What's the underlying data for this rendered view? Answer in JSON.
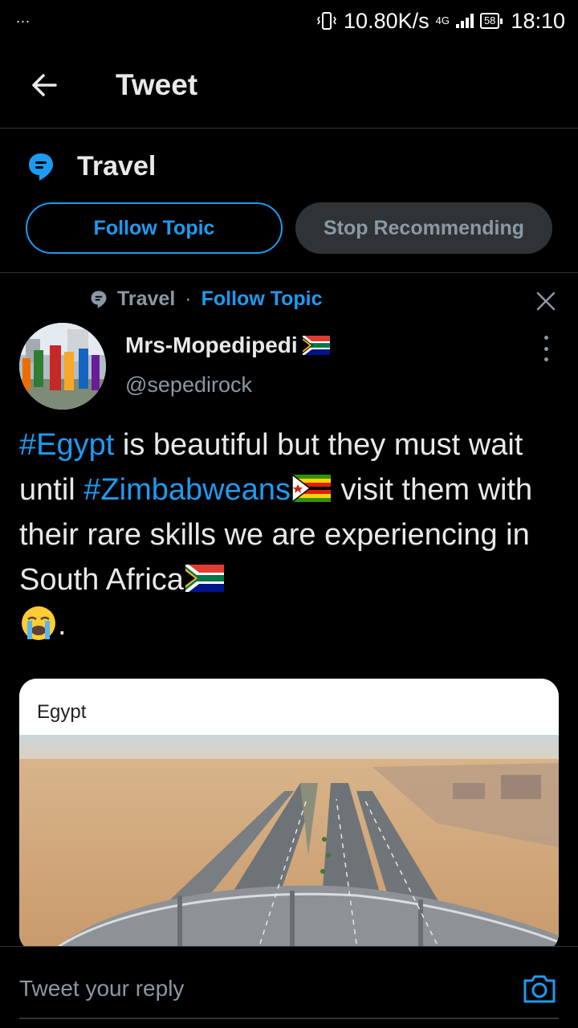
{
  "status_bar": {
    "dots": "...",
    "speed": "10.80K/s",
    "network": "4G",
    "battery": "58",
    "time": "18:10"
  },
  "header": {
    "back_icon": "arrow-left-icon",
    "title": "Tweet"
  },
  "topic_banner": {
    "icon": "topic-bubble-icon",
    "topic": "Travel",
    "follow_label": "Follow Topic",
    "stop_label": "Stop Recommending"
  },
  "tweet": {
    "context_topic": "Travel",
    "context_sep": "·",
    "context_follow": "Follow Topic",
    "author_name": "Mrs-Mopedipedi",
    "handle": "@sepedirock",
    "text": {
      "tag1": "#Egypt",
      "part1": " is beautiful but they must wait until ",
      "tag2": "#Zimbabweans",
      "part2": " visit them with their rare skills we are experiencing in South Africa",
      "part3": "."
    },
    "media": {
      "caption": "Egypt"
    }
  },
  "reply": {
    "placeholder": "Tweet your reply"
  },
  "colors": {
    "accent": "#1d9bf0",
    "background": "#000000",
    "muted": "#8b98a5"
  }
}
